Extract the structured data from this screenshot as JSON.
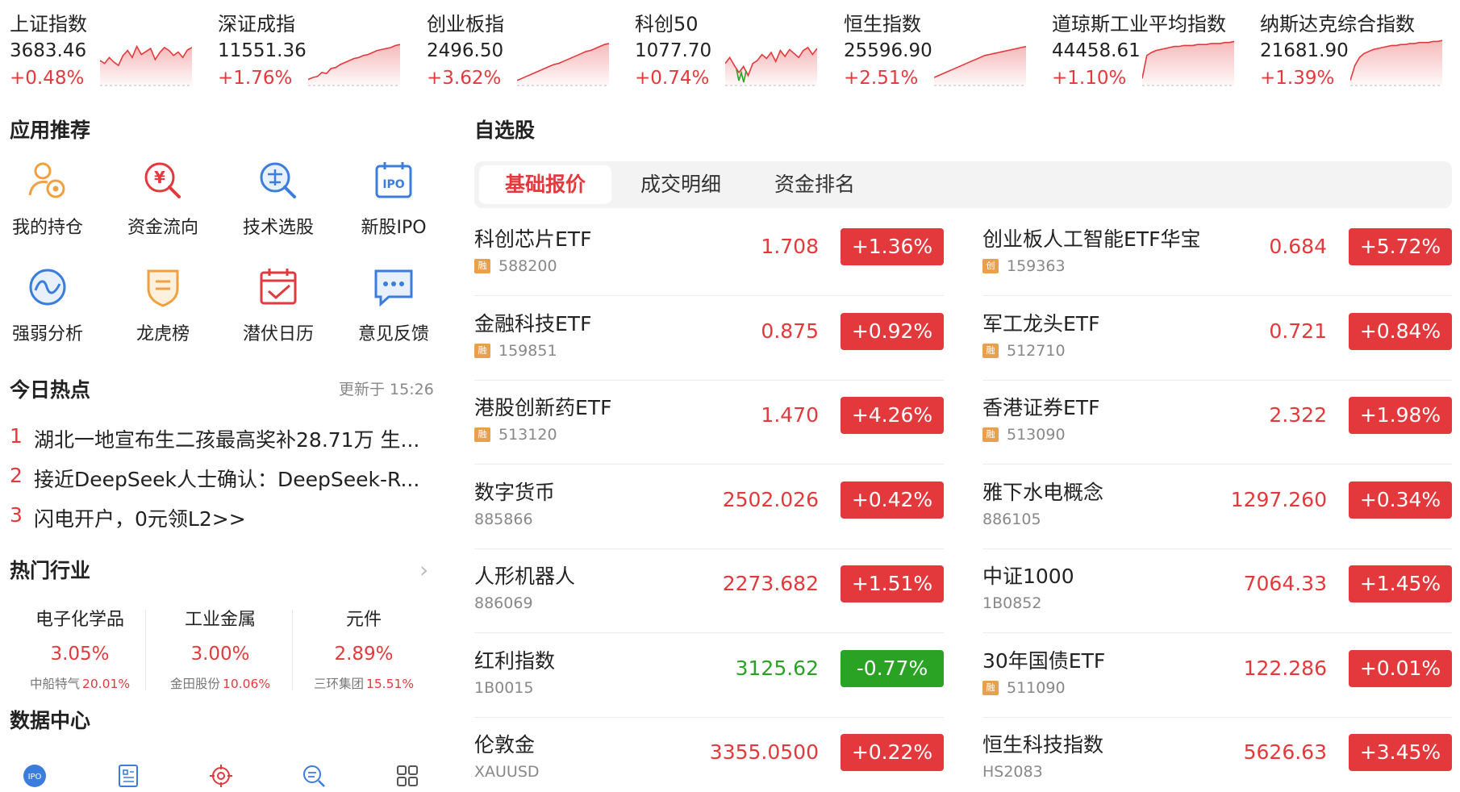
{
  "indices": [
    {
      "name": "上证指数",
      "value": "3683.46",
      "change": "+0.48%",
      "spark": [
        50,
        56,
        44,
        53,
        60,
        40,
        30,
        44,
        22,
        38,
        32,
        26,
        48,
        34,
        24,
        30,
        40,
        33,
        44,
        29,
        24
      ],
      "dip": false
    },
    {
      "name": "深证成指",
      "value": "11551.36",
      "change": "+1.76%",
      "spark": [
        88,
        84,
        82,
        74,
        76,
        66,
        64,
        58,
        54,
        50,
        46,
        44,
        40,
        38,
        34,
        30,
        28,
        26,
        24,
        20,
        18
      ],
      "dip": false
    },
    {
      "name": "创业板指",
      "value": "2496.50",
      "change": "+3.62%",
      "spark": [
        90,
        86,
        82,
        78,
        74,
        70,
        66,
        62,
        58,
        56,
        52,
        48,
        44,
        40,
        36,
        32,
        30,
        26,
        22,
        18,
        16
      ],
      "dip": false
    },
    {
      "name": "科创50",
      "value": "1077.70",
      "change": "+0.74%",
      "spark": [
        56,
        44,
        60,
        74,
        62,
        80,
        56,
        50,
        38,
        46,
        34,
        52,
        30,
        42,
        28,
        36,
        44,
        30,
        24,
        38,
        26
      ],
      "dip": true
    },
    {
      "name": "恒生指数",
      "value": "25596.90",
      "change": "+2.51%",
      "spark": [
        84,
        80,
        76,
        72,
        68,
        64,
        60,
        56,
        52,
        48,
        44,
        40,
        38,
        36,
        34,
        32,
        30,
        28,
        26,
        24,
        22
      ],
      "dip": false
    },
    {
      "name": "道琼斯工业平均指数",
      "value": "44458.61",
      "change": "+1.10%",
      "spark": [
        86,
        40,
        34,
        30,
        28,
        26,
        24,
        22,
        22,
        20,
        20,
        20,
        18,
        18,
        18,
        16,
        16,
        16,
        14,
        14,
        12
      ],
      "dip": false
    },
    {
      "name": "纳斯达克综合指数",
      "value": "21681.90",
      "change": "+1.39%",
      "spark": [
        90,
        60,
        44,
        36,
        32,
        28,
        26,
        24,
        22,
        20,
        20,
        18,
        18,
        16,
        16,
        14,
        14,
        14,
        12,
        12,
        10
      ],
      "dip": false
    }
  ],
  "apps": {
    "title": "应用推荐",
    "items": [
      {
        "label": "我的持仓",
        "icon": "holdings-icon"
      },
      {
        "label": "资金流向",
        "icon": "money-flow-icon"
      },
      {
        "label": "技术选股",
        "icon": "stock-picker-icon"
      },
      {
        "label": "新股IPO",
        "icon": "ipo-calendar-icon"
      },
      {
        "label": "强弱分析",
        "icon": "strength-analysis-icon"
      },
      {
        "label": "龙虎榜",
        "icon": "dragon-tiger-icon"
      },
      {
        "label": "潜伏日历",
        "icon": "calendar-check-icon"
      },
      {
        "label": "意见反馈",
        "icon": "feedback-icon"
      }
    ]
  },
  "hot": {
    "title": "今日热点",
    "updated": "更新于 15:26",
    "items": [
      {
        "num": "1",
        "text": "湖北一地宣布生二孩最高奖补28.71万 生..."
      },
      {
        "num": "2",
        "text": "接近DeepSeek人士确认：DeepSeek-R..."
      },
      {
        "num": "3",
        "text": "闪电开户，0元领L2>>"
      }
    ]
  },
  "industries": {
    "title": "热门行业",
    "items": [
      {
        "name": "电子化学品",
        "pct": "3.05%",
        "stock": "中船特气",
        "stock_pct": "20.01%"
      },
      {
        "name": "工业金属",
        "pct": "3.00%",
        "stock": "金田股份",
        "stock_pct": "10.06%"
      },
      {
        "name": "元件",
        "pct": "2.89%",
        "stock": "三环集团",
        "stock_pct": "15.51%"
      }
    ]
  },
  "data_center": {
    "title": "数据中心",
    "icons": [
      "ipo-badge-icon",
      "report-icon",
      "target-icon",
      "search-list-icon",
      "grid-icon"
    ],
    "ipo_text": "IPO"
  },
  "watchlist": {
    "title": "自选股",
    "tabs": [
      "基础报价",
      "成交明细",
      "资金排名"
    ],
    "active_tab": 0,
    "rows": [
      {
        "name": "科创芯片ETF",
        "code": "588200",
        "tag": "融",
        "price": "1.708",
        "change": "+1.36%",
        "up": true
      },
      {
        "name": "创业板人工智能ETF华宝",
        "code": "159363",
        "tag": "创",
        "price": "0.684",
        "change": "+5.72%",
        "up": true
      },
      {
        "name": "金融科技ETF",
        "code": "159851",
        "tag": "融",
        "price": "0.875",
        "change": "+0.92%",
        "up": true
      },
      {
        "name": "军工龙头ETF",
        "code": "512710",
        "tag": "融",
        "price": "0.721",
        "change": "+0.84%",
        "up": true
      },
      {
        "name": "港股创新药ETF",
        "code": "513120",
        "tag": "融",
        "price": "1.470",
        "change": "+4.26%",
        "up": true
      },
      {
        "name": "香港证券ETF",
        "code": "513090",
        "tag": "融",
        "price": "2.322",
        "change": "+1.98%",
        "up": true
      },
      {
        "name": "数字货币",
        "code": "885866",
        "tag": "",
        "price": "2502.026",
        "change": "+0.42%",
        "up": true
      },
      {
        "name": "雅下水电概念",
        "code": "886105",
        "tag": "",
        "price": "1297.260",
        "change": "+0.34%",
        "up": true
      },
      {
        "name": "人形机器人",
        "code": "886069",
        "tag": "",
        "price": "2273.682",
        "change": "+1.51%",
        "up": true
      },
      {
        "name": "中证1000",
        "code": "1B0852",
        "tag": "",
        "price": "7064.33",
        "change": "+1.45%",
        "up": true
      },
      {
        "name": "红利指数",
        "code": "1B0015",
        "tag": "",
        "price": "3125.62",
        "change": "-0.77%",
        "up": false
      },
      {
        "name": "30年国债ETF",
        "code": "511090",
        "tag": "融",
        "price": "122.286",
        "change": "+0.01%",
        "up": true
      },
      {
        "name": "伦敦金",
        "code": "XAUUSD",
        "tag": "",
        "price": "3355.0500",
        "change": "+0.22%",
        "up": true
      },
      {
        "name": "恒生科技指数",
        "code": "HS2083",
        "tag": "",
        "price": "5626.63",
        "change": "+3.45%",
        "up": true
      }
    ]
  },
  "colors": {
    "up": "#e4393c",
    "down": "#2aa324",
    "tag": "#e8a04c",
    "blue": "#3b7ddd",
    "orange": "#f0a040"
  }
}
